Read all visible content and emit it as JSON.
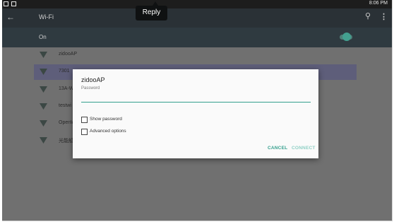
{
  "status_bar": {
    "time": "8:06 PM"
  },
  "app_bar": {
    "title": "Wi-Fi",
    "back_icon": "arrow-left-icon",
    "search_icon": "search-icon",
    "more_icon": "more-vert-icon"
  },
  "wifi_toggle": {
    "label": "On",
    "enabled": true,
    "accent": "#43a08f"
  },
  "networks": [
    {
      "name": "zidooAP",
      "selected": false
    },
    {
      "name": "7301",
      "selected": true
    },
    {
      "name": "13A-W",
      "selected": false
    },
    {
      "name": "testwi",
      "selected": false
    },
    {
      "name": "OpenW",
      "selected": false
    },
    {
      "name": "光能船",
      "selected": false
    }
  ],
  "dialog": {
    "title": "zidooAP",
    "password_label": "Password",
    "password_value": "",
    "show_password_label": "Show password",
    "advanced_options_label": "Advanced options",
    "cancel_label": "CANCEL",
    "connect_label": "CONNECT"
  },
  "tooltip": {
    "text": "Reply"
  }
}
